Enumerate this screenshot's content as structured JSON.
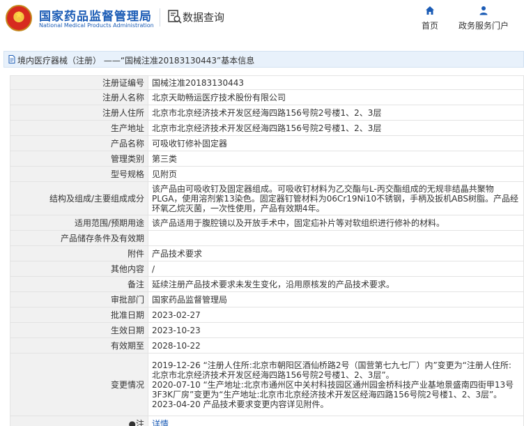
{
  "header": {
    "org_name_cn": "国家药品监督管理局",
    "org_name_en": "National Medical Products Administration",
    "page_title": "数据查询",
    "nav": [
      {
        "label": "首页",
        "icon": "home-icon"
      },
      {
        "label": "政务服务门户",
        "icon": "person-icon"
      }
    ]
  },
  "breadcrumb": {
    "text": "境内医疗器械（注册） ——“国械注准20183130443”基本信息"
  },
  "details": [
    {
      "key": "注册证编号",
      "value": "国械注准20183130443"
    },
    {
      "key": "注册人名称",
      "value": "北京天助畅运医疗技术股份有限公司"
    },
    {
      "key": "注册人住所",
      "value": "北京市北京经济技术开发区经海四路156号院2号楼1、2、3层"
    },
    {
      "key": "生产地址",
      "value": "北京市北京经济技术开发区经海四路156号院2号楼1、2、3层"
    },
    {
      "key": "产品名称",
      "value": "可吸收钉修补固定器"
    },
    {
      "key": "管理类别",
      "value": "第三类"
    },
    {
      "key": "型号规格",
      "value": "见附页"
    },
    {
      "key": "结构及组成/主要组成成分",
      "value": "该产品由可吸收钉及固定器组成。可吸收钉材料为乙交酯与L-丙交酯组成的无规非结晶共聚物PLGA，使用溶剂紫13染色。固定器钉管材料为06Cr19Ni10不锈钢，手柄及扳机ABS树脂。产品经环氧乙烷灭菌，一次性使用，产品有效期4年。"
    },
    {
      "key": "适用范围/预期用途",
      "value": "该产品适用于腹腔镜以及开放手术中，固定疝补片等对软组织进行修补的材料。"
    },
    {
      "key": "产品储存条件及有效期",
      "value": ""
    },
    {
      "key": "附件",
      "value": "产品技术要求"
    },
    {
      "key": "其他内容",
      "value": "/"
    },
    {
      "key": "备注",
      "value": "延续注册产品技术要求未发生变化，沿用原核发的产品技术要求。"
    },
    {
      "key": "审批部门",
      "value": "国家药品监督管理局"
    },
    {
      "key": "批准日期",
      "value": "2023-02-27"
    },
    {
      "key": "生效日期",
      "value": "2023-10-23"
    },
    {
      "key": "有效期至",
      "value": "2028-10-22"
    },
    {
      "key": "变更情况",
      "value": "2019-12-26  “注册人住所:北京市朝阳区酒仙桥路2号（国营第七九七厂）内”变更为“注册人住所:北京市北京经济技术开发区经海四路156号院2号楼1、2、3层”。\n2020-07-10  “生产地址:北京市通州区中关村科技园区通州园金桥科技产业基地景盛南四街甲13号3F3K厂房”变更为“生产地址:北京市北京经济技术开发区经海四路156号院2号楼1、2、3层”。\n2023-04-20 产品技术要求变更内容详见附件。"
    },
    {
      "key": "●注",
      "value": "详情"
    }
  ],
  "colors": {
    "brand_blue": "#1a5bb5",
    "key_bg": "#f1f1f1",
    "breadcrumb_bg": "#e8f1fb"
  }
}
